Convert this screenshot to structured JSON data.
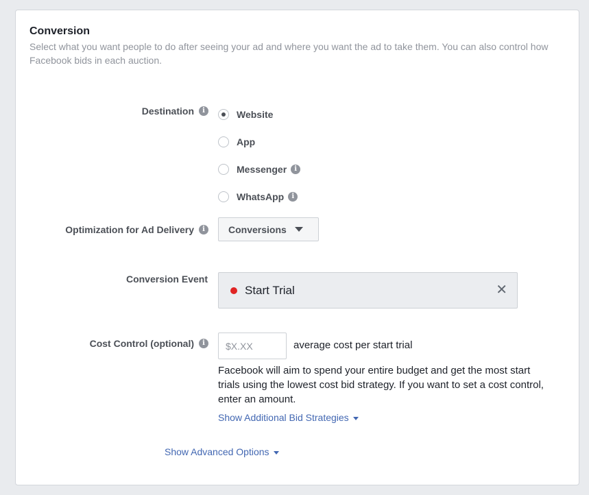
{
  "section": {
    "title": "Conversion",
    "subtitle": "Select what you want people to do after seeing your ad and where you want the ad to take them. You can also control how Facebook bids in each auction."
  },
  "destination": {
    "label": "Destination",
    "options": [
      {
        "label": "Website",
        "selected": true,
        "info": false
      },
      {
        "label": "App",
        "selected": false,
        "info": false
      },
      {
        "label": "Messenger",
        "selected": false,
        "info": true
      },
      {
        "label": "WhatsApp",
        "selected": false,
        "info": true
      }
    ]
  },
  "optimization": {
    "label": "Optimization for Ad Delivery",
    "selected": "Conversions"
  },
  "conversion_event": {
    "label": "Conversion Event",
    "value": "Start Trial",
    "status_color": "#e02424"
  },
  "cost_control": {
    "label": "Cost Control (optional)",
    "placeholder": "$X.XX",
    "suffix": "average cost per start trial",
    "help": "Facebook will aim to spend your entire budget and get the most start trials using the lowest cost bid strategy. If you want to set a cost control, enter an amount.",
    "bid_link": "Show Additional Bid Strategies"
  },
  "advanced_link": "Show Advanced Options",
  "colors": {
    "link": "#4267b2",
    "background": "#e9ebee"
  }
}
